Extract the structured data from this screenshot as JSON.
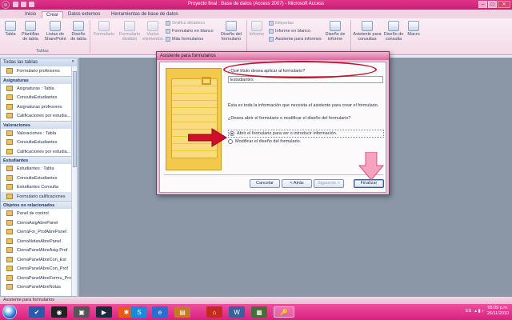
{
  "window": {
    "title": "Proyecto final : Base de datos (Access 2007) - Microsoft Access",
    "controls": [
      "–",
      "□",
      "✕"
    ]
  },
  "ribbon_tabs": [
    "Inicio",
    "Crear",
    "Datos externos",
    "Herramientas de base de datos"
  ],
  "ribbon": {
    "tabla": "Tabla",
    "plantillas": "Plantillas de tabla",
    "listas_sharepoint": "Listas de SharePoint",
    "diseno_tabla": "Diseño de tabla",
    "formulario": "Formulario",
    "formulario_dividido": "Formulario dividido",
    "varios_elementos": "Varios elementos",
    "grafico_dinamico": "Gráfico dinámico",
    "formulario_en_blanco": "Formulario en blanco",
    "mas_formularios": "Más formularios",
    "diseno_formulario": "Diseño del formulario",
    "informe": "Informe",
    "etiquetas": "Etiquetas",
    "informe_en_blanco": "Informe en blanco",
    "asistente_informes": "Asistente para informes",
    "diseno_informe": "Diseño de informe",
    "asistente_consultas": "Asistente para consultas",
    "diseno_consulta": "Diseño de consulta",
    "macro": "Macro",
    "group_tablas": "Tablas"
  },
  "nav": {
    "header": "Todas las tablas",
    "groups": [
      {
        "title": "",
        "items": [
          "Formulario profesores"
        ]
      },
      {
        "title": "Asignaturas",
        "items": [
          "Asignaturas : Tabla",
          "ConsultaEstudiantes",
          "Asignaturas profesores",
          "Calificaciones por estudia..."
        ]
      },
      {
        "title": "Valoraciones",
        "items": [
          "Valoraciones : Tabla",
          "ConsultaEstudiantes",
          "Calificaciones por estudia..."
        ]
      },
      {
        "title": "Estudiantes",
        "items": [
          "Estudiantes : Tabla",
          "ConsultaEstudiantes",
          "Estudiantes Consulta",
          "Formulario calificaciones"
        ]
      },
      {
        "title": "Objetos no relacionados",
        "items": [
          "Panel de control",
          "CierraAsigAbrePanel",
          "CierraFor_ProfAbrePanel",
          "CierraNotasAbrePanel",
          "CierraPanelAbreAsig-Prof",
          "CierraPanelAbreCon_Est",
          "CierraPanelAbreCon_Prof",
          "CierraPanelAbreFormu_Prof",
          "CierraPanelAbreNotas"
        ]
      }
    ]
  },
  "dialog": {
    "title": "Asistente para formularios",
    "question_title": "¿Qué título desea aplicar al formulario?",
    "title_value": "Estudiantes",
    "info": "Ésta es toda la información que necesita el asistente para crear el formulario.",
    "question_open": "¿Desea abrir el formulario o modificar el diseño del formulario?",
    "option_open": "Abrir el formulario para ver o introducir información.",
    "option_modify": "Modificar el diseño del formulario.",
    "btn_cancel": "Cancelar",
    "btn_back": "< Atrás",
    "btn_next": "Siguiente >",
    "btn_finish": "Finalizar"
  },
  "statusbar": "Asistente para formularios",
  "taskbar": {
    "lang": "ES",
    "time": "05:09 p.m.",
    "date": "26/11/2010"
  },
  "colors": {
    "accent": "#d8217f",
    "annotation_red": "#c8102e",
    "annotation_pink": "#f48fb1"
  }
}
